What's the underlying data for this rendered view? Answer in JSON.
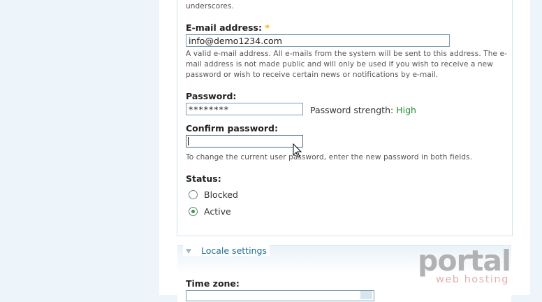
{
  "username_desc_tail": "underscores.",
  "email": {
    "label": "E-mail address:",
    "required_mark": "*",
    "value": "info@demo1234.com",
    "description": "A valid e-mail address. All e-mails from the system will be sent to this address. The e-mail address is not made public and will only be used if you wish to receive a new password or wish to receive certain news or notifications by e-mail."
  },
  "password": {
    "label": "Password:",
    "value": "********",
    "strength_label": "Password strength:",
    "strength_value": "High"
  },
  "confirm_password": {
    "label": "Confirm password:",
    "value": "",
    "description": "To change the current user password, enter the new password in both fields."
  },
  "status": {
    "label": "Status:",
    "options": [
      {
        "label": "Blocked",
        "checked": false
      },
      {
        "label": "Active",
        "checked": true
      }
    ]
  },
  "locale": {
    "legend": "Locale settings",
    "timezone_label": "Time zone:"
  },
  "watermark": {
    "brand": "portal",
    "sub": "web hosting"
  },
  "colors": {
    "accent_link": "#1d6e9b",
    "strength_high": "#218c2f",
    "required": "#ffae00"
  }
}
